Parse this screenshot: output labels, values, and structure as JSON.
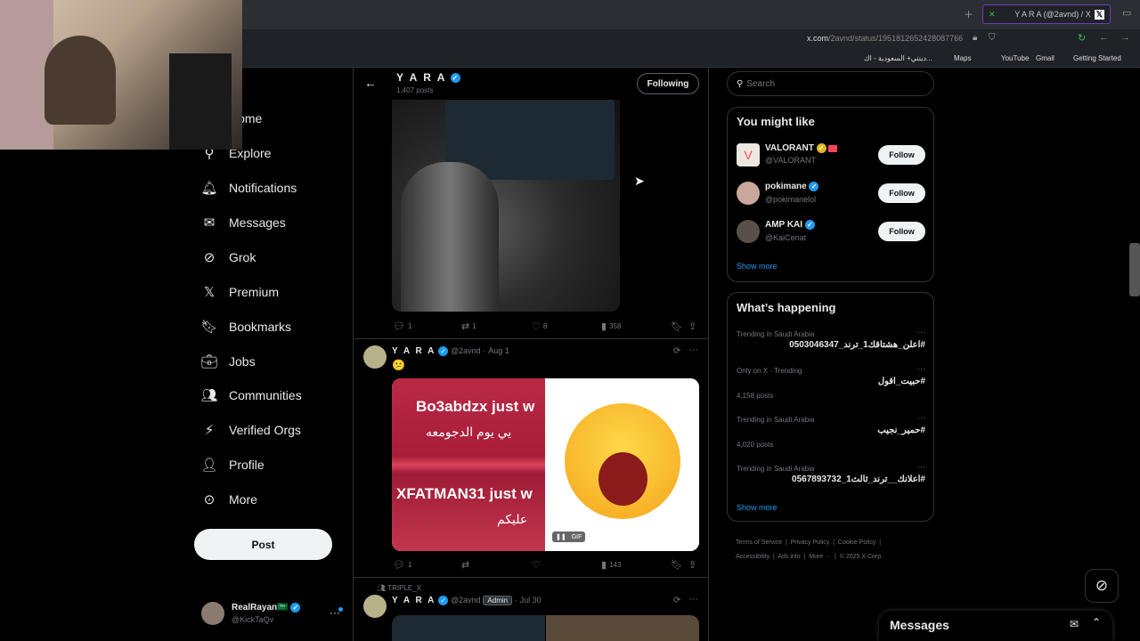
{
  "browser": {
    "tab_title": "Y A R A (@2avnd) / X",
    "url_domain": "x.com",
    "url_path": "/2avnd/status/1951812652428087766",
    "bookmarks": [
      "YouTube",
      "Gmail",
      "Getting Started",
      "Maps",
      "دينتي+ السعودية - اك..."
    ]
  },
  "nav": {
    "items": [
      {
        "label": "Home",
        "icon": "home-icon"
      },
      {
        "label": "Explore",
        "icon": "search-icon"
      },
      {
        "label": "Notifications",
        "icon": "bell-icon"
      },
      {
        "label": "Messages",
        "icon": "mail-icon"
      },
      {
        "label": "Grok",
        "icon": "grok-icon"
      },
      {
        "label": "Premium",
        "icon": "x-logo-icon"
      },
      {
        "label": "Bookmarks",
        "icon": "bookmark-icon"
      },
      {
        "label": "Jobs",
        "icon": "briefcase-icon"
      },
      {
        "label": "Communities",
        "icon": "people-icon"
      },
      {
        "label": "Verified Orgs",
        "icon": "lightning-icon"
      },
      {
        "label": "Profile",
        "icon": "person-icon"
      },
      {
        "label": "More",
        "icon": "more-circle-icon"
      }
    ],
    "post_label": "Post",
    "account": {
      "name": "RealRayan🇸🇦",
      "handle": "@KickTaQv"
    }
  },
  "header": {
    "name": "Y A R A",
    "posts": "1,407 posts",
    "following_label": "Following"
  },
  "post1": {
    "replies": "1",
    "reposts": "1",
    "likes": "8",
    "views": "358"
  },
  "post2": {
    "name": "Y A R A",
    "handle": "@2avnd",
    "date": "Aug 1",
    "text": "😕",
    "overlay_line1": "Bo3abdzx just w",
    "overlay_line2": "يي يوم الدجومعه",
    "overlay_line3": "XFATMAN31 just w",
    "overlay_line4": "عليكم",
    "gif_badge": "GIF",
    "replies": "1",
    "views": "143"
  },
  "post3": {
    "context": "TRIPLE_X",
    "name": "Y A R A",
    "handle": "@2avnd",
    "badge": "Admin",
    "date": "Jul 30"
  },
  "search": {
    "placeholder": "Search"
  },
  "you_might_like": {
    "title": "You might like",
    "follow_label": "Follow",
    "accounts": [
      {
        "name": "VALORANT",
        "handle": "@VALORANT"
      },
      {
        "name": "pokimane",
        "handle": "@pokimanelol"
      },
      {
        "name": "AMP KAI",
        "handle": "@KaiCenat"
      }
    ],
    "show_more": "Show more"
  },
  "whats_happening": {
    "title": "What’s happening",
    "trends": [
      {
        "category": "Trending in Saudi Arabia",
        "title": "#اعلن_هشتاقك1_ترند_0503046347",
        "count": ""
      },
      {
        "category": "Only on X · Trending",
        "title": "#حبيت_اقول",
        "count": "4,158 posts"
      },
      {
        "category": "Trending in Saudi Arabia",
        "title": "#حمير_نجيب",
        "count": "4,020 posts"
      },
      {
        "category": "Trending in Saudi Arabia",
        "title": "#اعلانك__ترند_ثالث1_0567893732",
        "count": ""
      }
    ],
    "show_more": "Show more"
  },
  "footer": {
    "links": [
      "Terms of Service",
      "Privacy Policy",
      "Cookie Policy",
      "Accessibility",
      "Ads info",
      "More ···",
      "© 2025 X Corp."
    ]
  },
  "messages_drawer": {
    "title": "Messages"
  },
  "colors": {
    "accent": "#1d9bf0",
    "background": "#000000",
    "border": "#2f3336",
    "muted": "#71767b"
  }
}
